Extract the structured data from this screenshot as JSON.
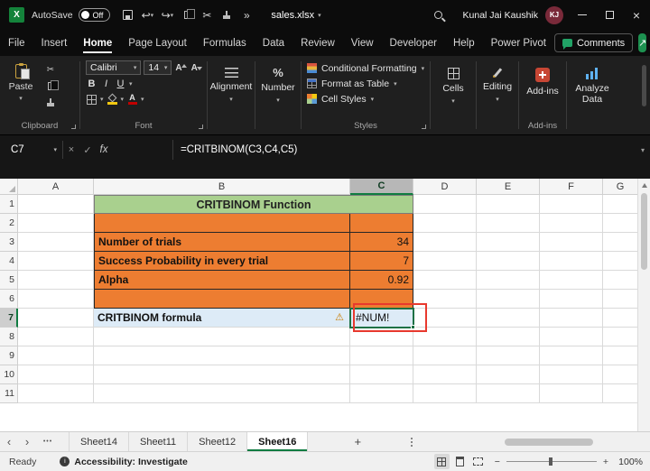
{
  "titlebar": {
    "autosave_label": "AutoSave",
    "autosave_state": "Off",
    "filename": "sales.xlsx",
    "user_name": "Kunal Jai Kaushik",
    "user_initials": "KJ"
  },
  "menu": {
    "tabs": [
      "File",
      "Insert",
      "Home",
      "Page Layout",
      "Formulas",
      "Data",
      "Review",
      "View",
      "Developer",
      "Help",
      "Power Pivot"
    ],
    "active_tab": "Home",
    "comments_label": "Comments"
  },
  "ribbon": {
    "paste_label": "Paste",
    "clipboard_group": "Clipboard",
    "font_name": "Calibri",
    "font_size": "14",
    "bold": "B",
    "italic": "I",
    "underline": "U",
    "font_letter": "A",
    "font_group": "Font",
    "alignment_label": "Alignment",
    "number_label": "Number",
    "percent": "%",
    "conditional_formatting": "Conditional Formatting",
    "format_as_table": "Format as Table",
    "cell_styles": "Cell Styles",
    "styles_group": "Styles",
    "cells_label": "Cells",
    "editing_label": "Editing",
    "addins_label": "Add-ins",
    "addins_group": "Add-ins",
    "analyze_label": "Analyze Data"
  },
  "formula_bar": {
    "name_box": "C7",
    "fx": "fx",
    "formula": "=CRITBINOM(C3,C4,C5)"
  },
  "grid": {
    "columns": [
      "A",
      "B",
      "C",
      "D",
      "E",
      "F",
      "G"
    ],
    "rows": [
      "1",
      "2",
      "3",
      "4",
      "5",
      "6",
      "7",
      "8",
      "9",
      "10",
      "11"
    ],
    "selected_cell": "C7",
    "title_cell": "CRITBINOM Function",
    "data_rows": [
      {
        "label": "Number of trials",
        "value": "34"
      },
      {
        "label": "Success Probability in every trial",
        "value": "7"
      },
      {
        "label": "Alpha",
        "value": "0.92"
      }
    ],
    "formula_label": "CRITBINOM formula",
    "result_value": "#NUM!"
  },
  "sheet_tabs": {
    "tabs": [
      "Sheet14",
      "Sheet11",
      "Sheet12",
      "Sheet16"
    ],
    "active": "Sheet16",
    "dots": "•••"
  },
  "status_bar": {
    "ready": "Ready",
    "accessibility": "Accessibility: Investigate",
    "zoom": "100%"
  },
  "icons": {
    "excel": "X",
    "chevron_down": "▾",
    "undo": "↩",
    "redo": "↪",
    "cut": "✂",
    "more": "»",
    "close": "×",
    "check": "✓",
    "warning": "⚠",
    "prev": "‹",
    "next": "›",
    "plus": "+",
    "minus": "−",
    "share_arrow": "↗",
    "person": "i"
  },
  "colors": {
    "excel_green": "#107C41",
    "orange_fill": "#ED7D31",
    "title_fill": "#A9D08E",
    "result_fill": "#DDEBF7",
    "selection_border": "#1E7145",
    "annotation_red": "#E8392E",
    "avatar": "#7A2A3A",
    "addins_icon": "#C74634"
  }
}
